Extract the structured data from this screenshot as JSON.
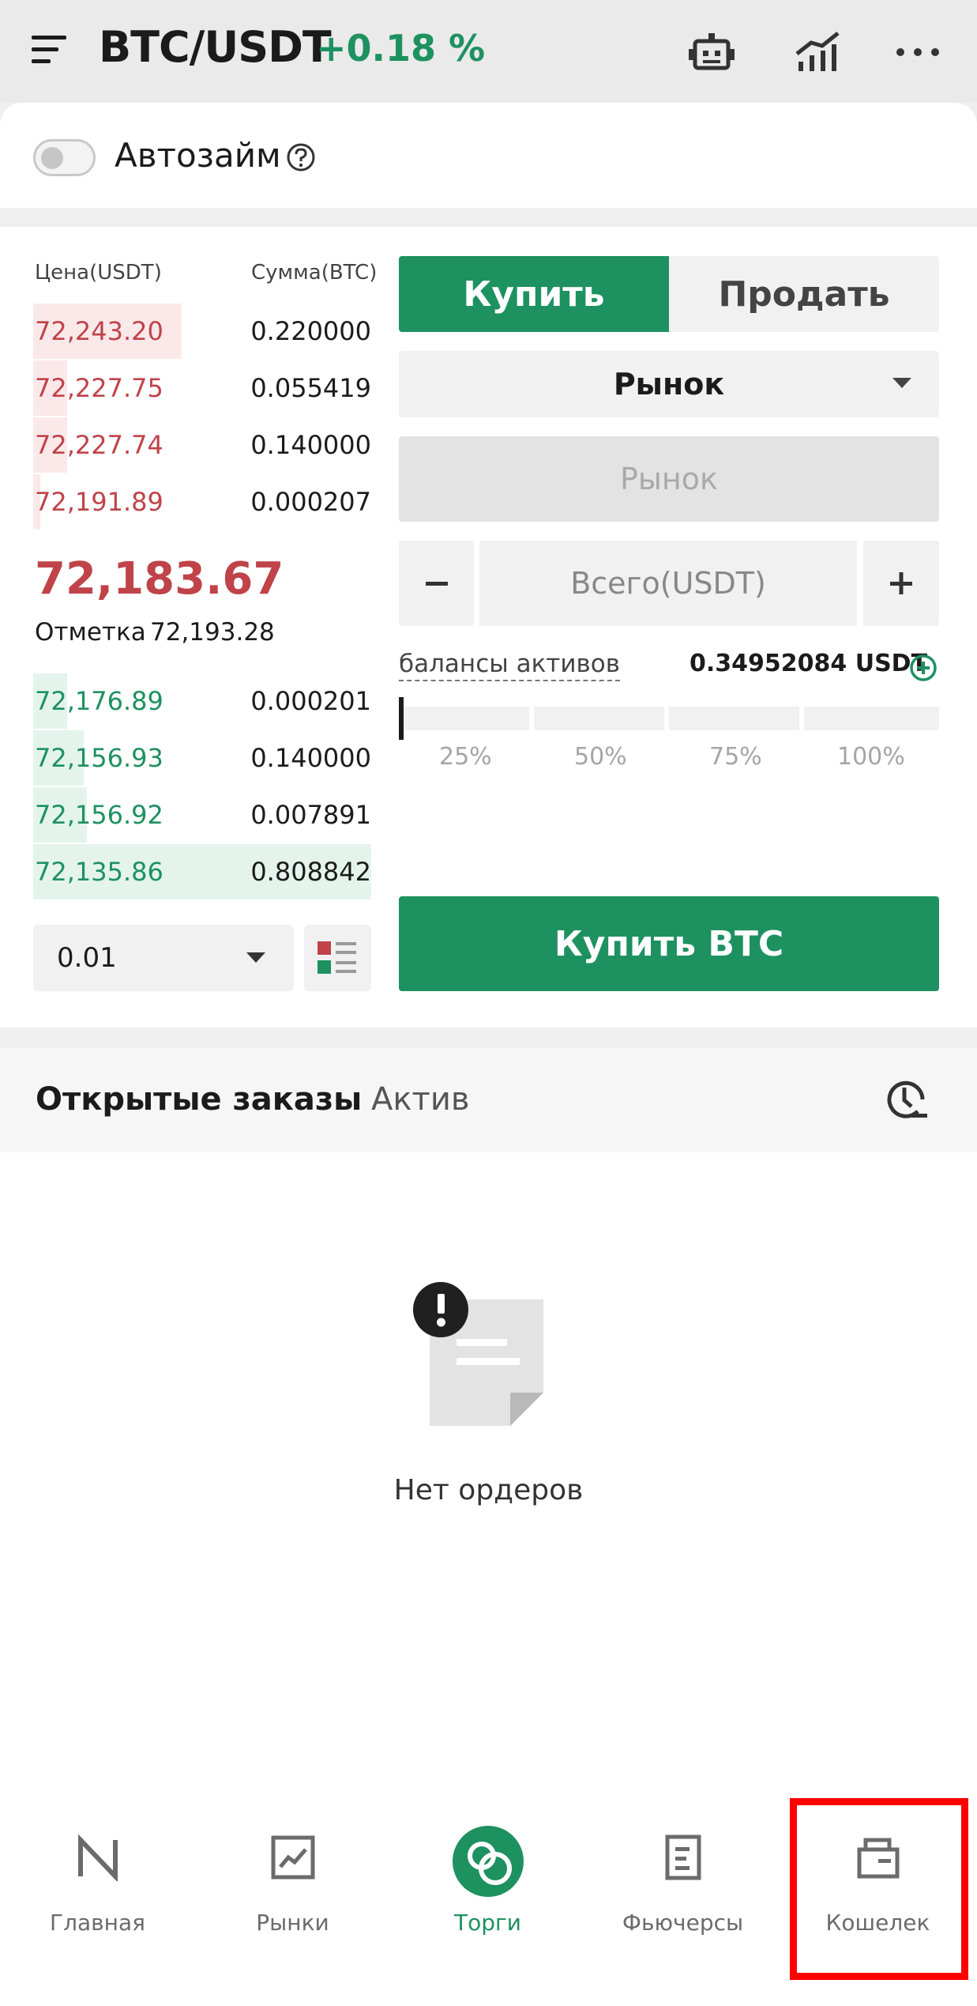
{
  "header": {
    "pair": "BTC/USDT",
    "change": "+0.18 %",
    "icons": [
      "menu-icon",
      "bot-icon",
      "chart-icon",
      "more-icon"
    ]
  },
  "autoloan": {
    "label": "Автозайм",
    "enabled": false
  },
  "orderbook": {
    "price_header": "Цена(USDT)",
    "amount_header": "Сумма(BTC)",
    "asks": [
      {
        "price": "72,243.20",
        "amount": "0.220000",
        "depth": 0.44
      },
      {
        "price": "72,227.75",
        "amount": "0.055419",
        "depth": 0.1
      },
      {
        "price": "72,227.74",
        "amount": "0.140000",
        "depth": 0.1
      },
      {
        "price": "72,191.89",
        "amount": "0.000207",
        "depth": 0.02
      }
    ],
    "last_price": "72,183.67",
    "mark_label": "Отметка",
    "mark_value": "72,193.28",
    "bids": [
      {
        "price": "72,176.89",
        "amount": "0.000201",
        "depth": 0.1
      },
      {
        "price": "72,156.93",
        "amount": "0.140000",
        "depth": 0.15
      },
      {
        "price": "72,156.92",
        "amount": "0.007891",
        "depth": 0.16
      },
      {
        "price": "72,135.86",
        "amount": "0.808842",
        "depth": 1.0
      }
    ],
    "precision": "0.01"
  },
  "trade": {
    "buy_tab": "Купить",
    "sell_tab": "Продать",
    "order_type": "Рынок",
    "price_placeholder": "Рынок",
    "total_placeholder": "Всего(USDT)",
    "balance_label": "балансы активов",
    "balance_value": "0.34952084 USDT",
    "slider_marks": [
      "25%",
      "50%",
      "75%",
      "100%"
    ],
    "slider_value": 0,
    "submit_label": "Купить BTC"
  },
  "orders": {
    "tab_open": "Открытые заказы",
    "tab_asset": "Актив",
    "empty_text": "Нет ордеров"
  },
  "nav": {
    "items": [
      {
        "label": "Главная",
        "icon": "home-icon"
      },
      {
        "label": "Рынки",
        "icon": "markets-icon"
      },
      {
        "label": "Торги",
        "icon": "trade-icon"
      },
      {
        "label": "Фьючерсы",
        "icon": "futures-icon"
      },
      {
        "label": "Кошелек",
        "icon": "wallet-icon"
      }
    ],
    "active": "Торги"
  },
  "colors": {
    "buy_green": "#1e9160",
    "sell_red": "#c0434a",
    "highlight": "#ff0000"
  }
}
